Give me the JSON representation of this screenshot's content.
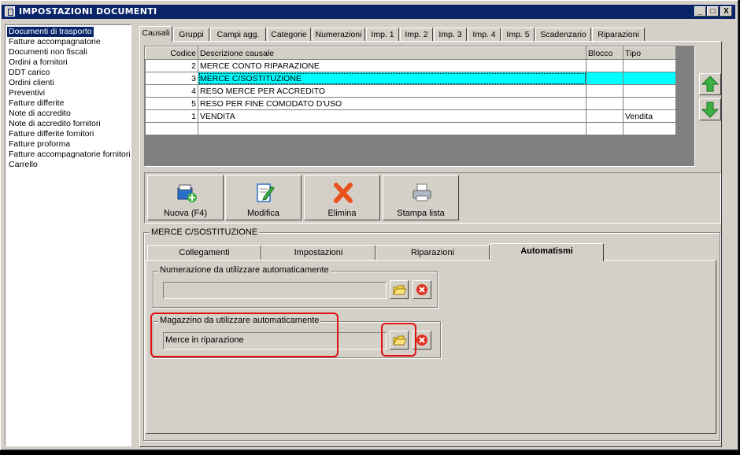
{
  "window": {
    "title": "IMPOSTAZIONI DOCUMENTI",
    "minimize": "_",
    "maximize": "□",
    "close": "X"
  },
  "doc_types": [
    "Documenti di trasporto",
    "Fatture accompagnatorie",
    "Documenti non fiscali",
    "Ordini a fornitori",
    "DDT carico",
    "Ordini clienti",
    "Preventivi",
    "Fatture differite",
    "Note di accredito",
    "Note di accredito fornitori",
    "Fatture differite fornitori",
    "Fatture proforma",
    "Fatture accompagnatorie fornitori",
    "Carrello"
  ],
  "tabs": [
    "Causali",
    "Gruppi",
    "Campi agg.",
    "Categorie",
    "Numerazioni",
    "Imp. 1",
    "Imp. 2",
    "Imp. 3",
    "Imp. 4",
    "Imp. 5",
    "Scadenzario",
    "Riparazioni"
  ],
  "grid": {
    "headers": {
      "codice": "Codice",
      "descrizione": "Descrizione causale",
      "blocco": "Blocco",
      "tipo": "Tipo"
    },
    "rows": [
      {
        "codice": "2",
        "descrizione": "MERCE CONTO RIPARAZIONE",
        "blocco": "",
        "tipo": ""
      },
      {
        "codice": "3",
        "descrizione": "MERCE C/SOSTITUZIONE",
        "blocco": "",
        "tipo": ""
      },
      {
        "codice": "4",
        "descrizione": "RESO MERCE PER ACCREDITO",
        "blocco": "",
        "tipo": ""
      },
      {
        "codice": "5",
        "descrizione": "RESO PER FINE COMODATO D'USO",
        "blocco": "",
        "tipo": ""
      },
      {
        "codice": "1",
        "descrizione": "VENDITA",
        "blocco": "",
        "tipo": "Vendita"
      }
    ]
  },
  "toolbar": {
    "new_label": "Nuova (F4)",
    "edit_label": "Modifica",
    "delete_label": "Elimina",
    "print_label": "Stampa lista"
  },
  "detail": {
    "group_title": "MERCE C/SOSTITUZIONE",
    "subtabs": [
      "Collegamenti",
      "Impostazioni",
      "Riparazioni",
      "Automatismi"
    ],
    "numerazione_label": "Numerazione da utilizzare automaticamente",
    "numerazione_value": "",
    "magazzino_label": "Magazzino da utilizzare automaticamente",
    "magazzino_value": "Merce in riparazione"
  },
  "colors": {
    "selection": "#00ffff",
    "titlebar": "#0a246a",
    "highlight_box": "#e01010"
  }
}
